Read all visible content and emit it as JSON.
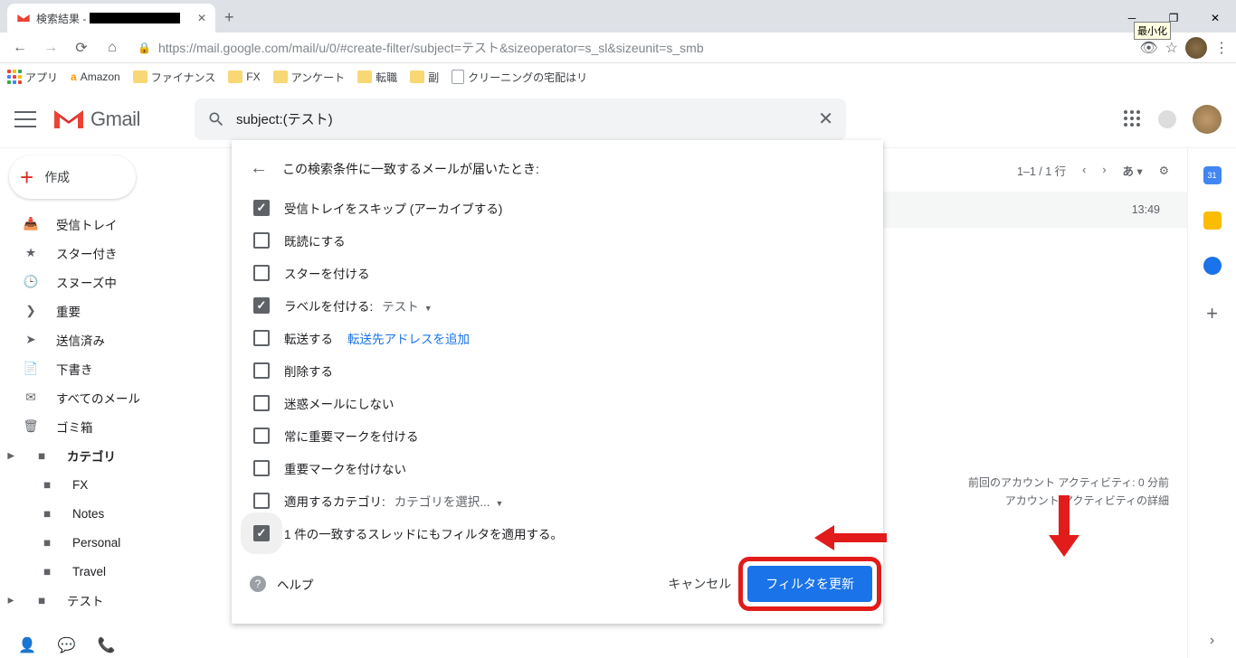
{
  "browser": {
    "tab_title_prefix": "検索結果 -",
    "url": "https://mail.google.com/mail/u/0/#create-filter/subject=テスト&sizeoperator=s_sl&sizeunit=s_smb",
    "win_tooltip": "最小化"
  },
  "bookmarks": {
    "apps": "アプリ",
    "items": [
      "Amazon",
      "ファイナンス",
      "FX",
      "アンケート",
      "転職",
      "副",
      "クリーニングの宅配はリ"
    ]
  },
  "gmail": {
    "brand": "Gmail",
    "search_value": "subject:(テスト)"
  },
  "sidebar": {
    "compose": "作成",
    "items": [
      {
        "label": "受信トレイ"
      },
      {
        "label": "スター付き"
      },
      {
        "label": "スヌーズ中"
      },
      {
        "label": "重要"
      },
      {
        "label": "送信済み"
      },
      {
        "label": "下書き"
      },
      {
        "label": "すべてのメール"
      },
      {
        "label": "ゴミ箱"
      },
      {
        "label": "カテゴリ",
        "bold": true,
        "caret": true
      },
      {
        "label": "FX",
        "sub": true
      },
      {
        "label": "Notes",
        "sub": true
      },
      {
        "label": "Personal",
        "sub": true
      },
      {
        "label": "Travel",
        "sub": true
      },
      {
        "label": "テスト",
        "sub": true,
        "caret": true
      }
    ]
  },
  "toolbar": {
    "count": "1–1 / 1 行",
    "lang": "あ",
    "time": "13:49"
  },
  "filter": {
    "heading": "この検索条件に一致するメールが届いたとき:",
    "options": [
      {
        "label": "受信トレイをスキップ (アーカイブする)",
        "checked": true
      },
      {
        "label": "既読にする",
        "checked": false
      },
      {
        "label": "スターを付ける",
        "checked": false
      },
      {
        "label": "ラベルを付ける:",
        "checked": true,
        "dd_value": "テスト"
      },
      {
        "label": "転送する",
        "checked": false,
        "link": "転送先アドレスを追加"
      },
      {
        "label": "削除する",
        "checked": false
      },
      {
        "label": "迷惑メールにしない",
        "checked": false
      },
      {
        "label": "常に重要マークを付ける",
        "checked": false
      },
      {
        "label": "重要マークを付けない",
        "checked": false
      },
      {
        "label": "適用するカテゴリ:",
        "checked": false,
        "dd_value": "カテゴリを選択..."
      },
      {
        "label": "1 件の一致するスレッドにもフィルタを適用する。",
        "checked": true,
        "highlighted": true
      }
    ],
    "help": "ヘルプ",
    "cancel": "キャンセル",
    "update": "フィルタを更新"
  },
  "footer": {
    "line1": "前回のアカウント アクティビティ: 0 分前",
    "line2": "アカウント アクティビティの詳細"
  },
  "rail": {
    "cal_day": "31"
  }
}
